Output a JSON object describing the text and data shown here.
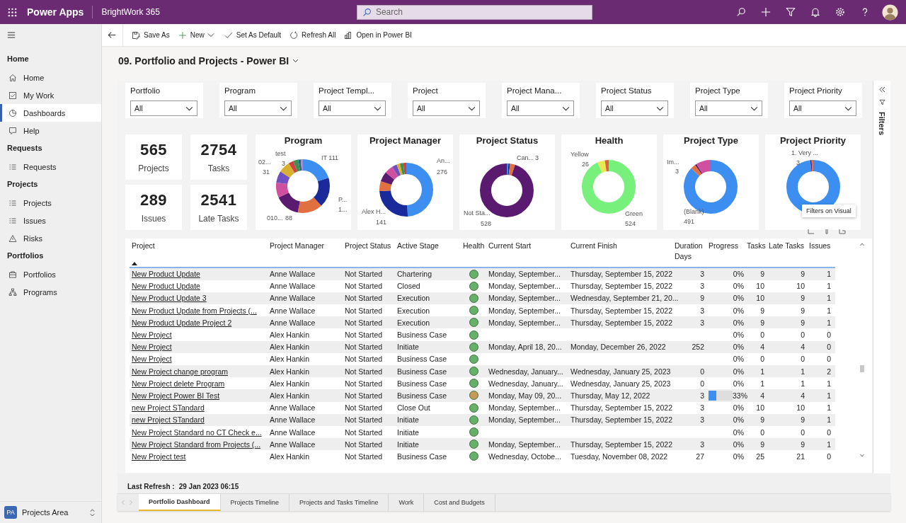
{
  "app_bar": {
    "app_name": "Power Apps",
    "environment": "BrightWork 365",
    "search": {
      "placeholder": "Search"
    }
  },
  "command_bar": [
    {
      "label": "Save As",
      "kind": "save"
    },
    {
      "label": "New",
      "kind": "new"
    },
    {
      "label": "Set As Default",
      "kind": "check"
    },
    {
      "label": "Refresh All",
      "kind": "refresh"
    },
    {
      "label": "Open in Power BI",
      "kind": "powerbi"
    }
  ],
  "sidebar": {
    "sections": [
      {
        "heading": "Home",
        "items": [
          {
            "label": "Home",
            "kind": "home",
            "selected": false
          },
          {
            "label": "My Work",
            "kind": "checkbox",
            "selected": false
          },
          {
            "label": "Dashboards",
            "kind": "dashboard",
            "selected": true
          },
          {
            "label": "Help",
            "kind": "help",
            "selected": false
          }
        ]
      },
      {
        "heading": "Requests",
        "items": [
          {
            "label": "Requests",
            "kind": "list",
            "selected": false
          }
        ]
      },
      {
        "heading": "Projects",
        "items": [
          {
            "label": "Projects",
            "kind": "list",
            "selected": false
          },
          {
            "label": "Issues",
            "kind": "issues",
            "selected": false
          },
          {
            "label": "Risks",
            "kind": "risk",
            "selected": false
          }
        ]
      },
      {
        "heading": "Portfolios",
        "items": [
          {
            "label": "Portfolios",
            "kind": "folder",
            "selected": false
          },
          {
            "label": "Programs",
            "kind": "hierarchy",
            "selected": false
          }
        ]
      }
    ],
    "area": {
      "badge": "PA",
      "label": "Projects Area"
    }
  },
  "page_title": "09. Portfolio and Projects - Power BI",
  "report": {
    "slicers": [
      {
        "label": "Portfolio",
        "value": "All"
      },
      {
        "label": "Program",
        "value": "All"
      },
      {
        "label": "Project Templ...",
        "value": "All"
      },
      {
        "label": "Project",
        "value": "All"
      },
      {
        "label": "Project Mana...",
        "value": "All"
      },
      {
        "label": "Project Status",
        "value": "All"
      },
      {
        "label": "Project Type",
        "value": "All"
      },
      {
        "label": "Project Priority",
        "value": "All"
      }
    ],
    "cards": [
      {
        "value": "565",
        "label": "Projects"
      },
      {
        "value": "2754",
        "label": "Tasks"
      },
      {
        "value": "289",
        "label": "Issues"
      },
      {
        "value": "2541",
        "label": "Late Tasks"
      }
    ],
    "donuts": [
      {
        "title": "Program",
        "labels": [
          "test",
          "02...",
          "3",
          "31",
          "IT 111",
          "P...",
          "1...",
          "010...",
          "88"
        ]
      },
      {
        "title": "Project Manager",
        "labels": [
          "An...",
          "276",
          "Alex H...",
          "141"
        ]
      },
      {
        "title": "Project Status",
        "labels": [
          "Can...",
          "3",
          "Not Sta...",
          "528"
        ]
      },
      {
        "title": "Health",
        "labels": [
          "Yellow",
          "26",
          "Green",
          "524"
        ]
      },
      {
        "title": "Project Type",
        "labels": [
          "Im...",
          "3",
          "(Blank)",
          "491"
        ]
      },
      {
        "title": "Project Priority",
        "labels": [
          "1. Very ...",
          "3"
        ]
      }
    ],
    "tooltip": "Filters on Visual",
    "table": {
      "columns": [
        "Project",
        "Project Manager",
        "Project Status",
        "Active Stage",
        "Health",
        "Current Start",
        "Current Finish",
        "Duration Days",
        "Progress",
        "Tasks",
        "Late Tasks",
        "Issues"
      ],
      "rows": [
        {
          "project": "New Product Update",
          "manager": "Anne Wallace",
          "status": "Not Started",
          "stage": "Chartering",
          "color": "#66b06a",
          "start": "Monday, September...",
          "finish": "Thursday, September 15, 2022",
          "duration": "3",
          "progress": "0%",
          "tasks": "9",
          "late_tasks": "9",
          "issues": "1"
        },
        {
          "project": "New Product Update",
          "manager": "Anne Wallace",
          "status": "Not Started",
          "stage": "Closed",
          "color": "#66b06a",
          "start": "Monday, September...",
          "finish": "Thursday, September 15, 2022",
          "duration": "3",
          "progress": "0%",
          "tasks": "10",
          "late_tasks": "10",
          "issues": "1"
        },
        {
          "project": "New Product Update 3",
          "manager": "Anne Wallace",
          "status": "Not Started",
          "stage": "Execution",
          "color": "#66b06a",
          "start": "Monday, September...",
          "finish": "Wednesday, September 21, 20...",
          "duration": "9",
          "progress": "0%",
          "tasks": "10",
          "late_tasks": "9",
          "issues": "1"
        },
        {
          "project": "New Product Update from Projects (...",
          "manager": "Anne Wallace",
          "status": "Not Started",
          "stage": "Execution",
          "color": "#66b06a",
          "start": "Monday, September...",
          "finish": "Thursday, September 15, 2022",
          "duration": "3",
          "progress": "0%",
          "tasks": "9",
          "late_tasks": "9",
          "issues": "1"
        },
        {
          "project": "New Product Update Project 2",
          "manager": "Anne Wallace",
          "status": "Not Started",
          "stage": "Execution",
          "color": "#66b06a",
          "start": "Monday, September...",
          "finish": "Thursday, September 15, 2022",
          "duration": "3",
          "progress": "0%",
          "tasks": "9",
          "late_tasks": "9",
          "issues": "1"
        },
        {
          "project": "New Project",
          "manager": "Alex Hankin",
          "status": "Not Started",
          "stage": "Business Case",
          "color": "#66b06a",
          "progress": "0%",
          "tasks": "0",
          "late_tasks": "0",
          "issues": "0"
        },
        {
          "project": "New Project",
          "manager": "Alex Hankin",
          "status": "Not Started",
          "stage": "Initiate",
          "color": "#66b06a",
          "start": "Monday, April 18, 20...",
          "finish": "Monday, December 26, 2022",
          "duration": "252",
          "progress": "0%",
          "tasks": "4",
          "late_tasks": "4",
          "issues": "0"
        },
        {
          "project": "New Project",
          "manager": "Alex Hankin",
          "status": "Not Started",
          "stage": "Business Case",
          "color": "#66b06a",
          "progress": "0%",
          "tasks": "0",
          "late_tasks": "0",
          "issues": "0"
        },
        {
          "project": "New Project change program",
          "manager": "Alex Hankin",
          "status": "Not Started",
          "stage": "Business Case",
          "color": "#66b06a",
          "start": "Wednesday, January...",
          "finish": "Wednesday, January 25, 2023",
          "duration": "0",
          "progress": "0%",
          "tasks": "1",
          "late_tasks": "1",
          "issues": "2"
        },
        {
          "project": "New Project delete Program",
          "manager": "Alex Hankin",
          "status": "Not Started",
          "stage": "Business Case",
          "color": "#66b06a",
          "start": "Wednesday, January...",
          "finish": "Wednesday, January 25, 2023",
          "duration": "0",
          "progress": "0%",
          "tasks": "1",
          "late_tasks": "1",
          "issues": "1"
        },
        {
          "project": "New Project Power BI Test",
          "manager": "Alex Hankin",
          "status": "Not Started",
          "stage": "Business Case",
          "color": "#c89a5a",
          "start": "Monday, May 09, 20...",
          "finish": "Thursday, May 12, 2022",
          "duration": "3",
          "level": 0.33,
          "progress": "33%",
          "tasks": "4",
          "late_tasks": "4",
          "issues": "1"
        },
        {
          "project": "new Project STandard",
          "manager": "Anne Wallace",
          "status": "Not Started",
          "stage": "Close Out",
          "color": "#66b06a",
          "start": "Monday, September...",
          "finish": "Thursday, September 15, 2022",
          "duration": "3",
          "progress": "0%",
          "tasks": "10",
          "late_tasks": "10",
          "issues": "1"
        },
        {
          "project": "new Project STandard",
          "manager": "Anne Wallace",
          "status": "Not Started",
          "stage": "Initiate",
          "color": "#66b06a",
          "start": "Monday, September...",
          "finish": "Thursday, September 15, 2022",
          "duration": "3",
          "progress": "0%",
          "tasks": "9",
          "late_tasks": "9",
          "issues": "1"
        },
        {
          "project": "New Project Standard  no CT Check e...",
          "manager": "Anne Wallace",
          "status": "Not Started",
          "stage": "Initiate",
          "color": "#66b06a",
          "progress": "0%",
          "tasks": "0",
          "late_tasks": "0",
          "issues": "0"
        },
        {
          "project": "New Project Standard from Projects (...",
          "manager": "Anne Wallace",
          "status": "Not Started",
          "stage": "Initiate",
          "color": "#66b06a",
          "start": "Monday, September...",
          "finish": "Thursday, September 15, 2022",
          "duration": "3",
          "progress": "0%",
          "tasks": "9",
          "late_tasks": "9",
          "issues": "1"
        },
        {
          "project": "New Project test",
          "manager": "Alex Hankin",
          "status": "Not Started",
          "stage": "Business Case",
          "color": "#66b06a",
          "start": "Wednesday, Octobe...",
          "finish": "Tuesday, November 08, 2022",
          "duration": "27",
          "progress": "0%",
          "tasks": "25",
          "late_tasks": "21",
          "issues": "0"
        }
      ]
    },
    "last_refresh": {
      "label": "Last Refresh :",
      "value": "29 Jan 2023 06:15"
    },
    "tabs": [
      {
        "label": "Portfolio Dashboard",
        "selected": true
      },
      {
        "label": "Projects Timeline",
        "selected": false
      },
      {
        "label": "Projects and Tasks Timeline",
        "selected": false
      },
      {
        "label": "Work",
        "selected": false
      },
      {
        "label": "Cost and Budgets",
        "selected": false
      }
    ]
  },
  "filters_pane": {
    "label": "Filters"
  }
}
